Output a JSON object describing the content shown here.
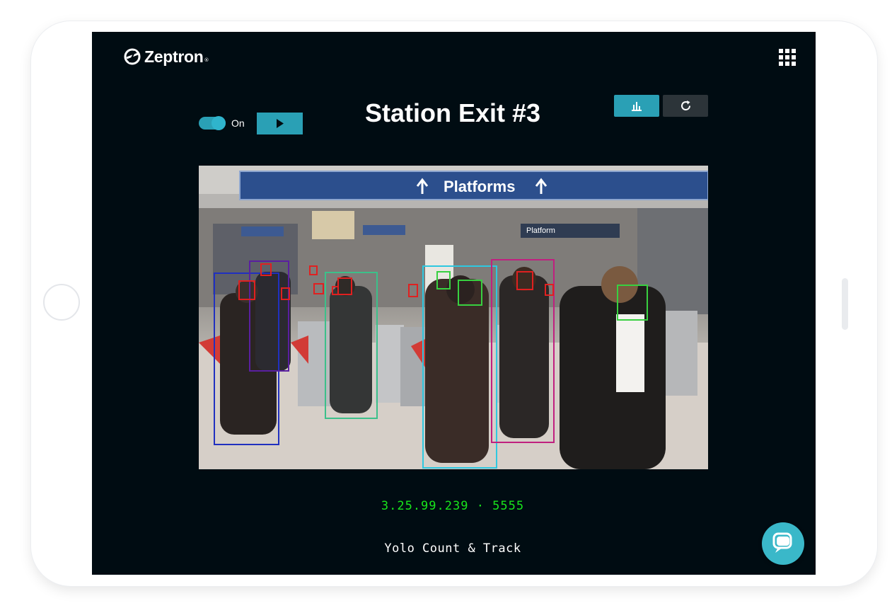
{
  "app": {
    "brand": "Zeptron"
  },
  "header": {
    "apps_menu_icon": "grid-icon"
  },
  "controls": {
    "toggle_label": "On",
    "toggle_on": true,
    "play_icon": "play-icon",
    "chart_icon": "bar-chart-icon",
    "refresh_icon": "refresh-icon"
  },
  "camera": {
    "title": "Station Exit #3",
    "sign_text": "Platforms",
    "platform_text": "Platform",
    "stream_address": "3.25.99.239 · 5555",
    "caption": "Yolo Count & Track"
  },
  "chat": {
    "icon": "chat-icon"
  },
  "colors": {
    "accent": "#2aa0b5",
    "screen_background": "#000c12",
    "stream_address": "#18e51c",
    "secondary_button": "#2c3439"
  }
}
